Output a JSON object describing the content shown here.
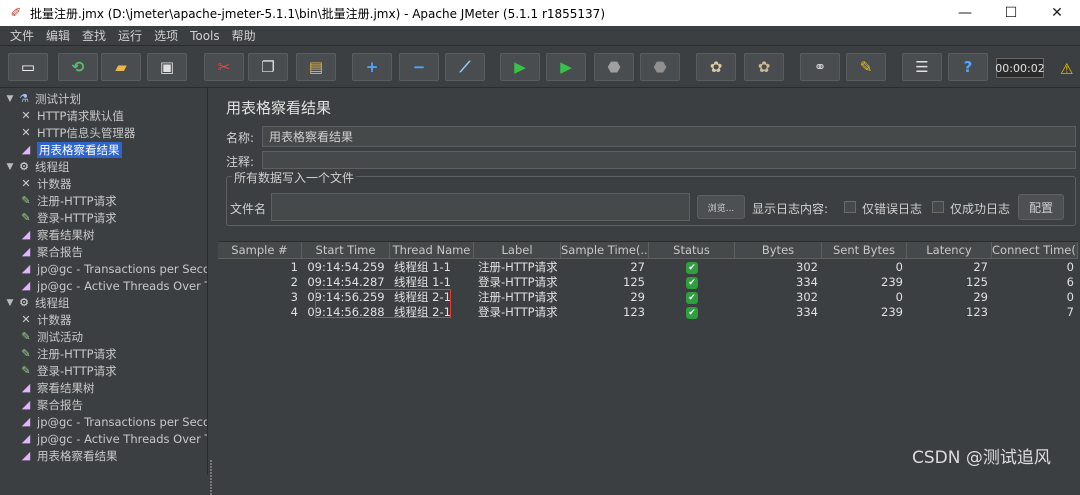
{
  "window": {
    "title": "批量注册.jmx (D:\\jmeter\\apache-jmeter-5.1.1\\bin\\批量注册.jmx) - Apache JMeter (5.1.1 r1855137)",
    "minimize": "—",
    "maximize": "☐",
    "close": "✕",
    "app_icon": "✐"
  },
  "menu": [
    "文件",
    "编辑",
    "查找",
    "运行",
    "选项",
    "Tools",
    "帮助"
  ],
  "toolbar": {
    "buttons": [
      {
        "name": "new-icon",
        "glyph": "▭",
        "color": "#ffffff"
      },
      {
        "name": "templates-icon",
        "glyph": "⟲",
        "color": "#55c06a"
      },
      {
        "name": "open-icon",
        "glyph": "▰",
        "color": "#e8b84a"
      },
      {
        "name": "save-icon",
        "glyph": "▣",
        "color": "#e0e0e0"
      },
      {
        "name": "cut-icon",
        "glyph": "✂",
        "color": "#e04848"
      },
      {
        "name": "copy-icon",
        "glyph": "❐",
        "color": "#e0e0e0"
      },
      {
        "name": "paste-icon",
        "glyph": "▤",
        "color": "#e8b84a"
      },
      {
        "name": "expand-icon",
        "glyph": "+",
        "color": "#4ea6ff"
      },
      {
        "name": "collapse-icon",
        "glyph": "−",
        "color": "#4ea6ff"
      },
      {
        "name": "toggle-icon",
        "glyph": "⟋",
        "color": "#9ad0ff"
      },
      {
        "name": "start-icon",
        "glyph": "▶",
        "color": "#39c24a"
      },
      {
        "name": "start-no-pause-icon",
        "glyph": "▶",
        "color": "#39c24a"
      },
      {
        "name": "stop-icon",
        "glyph": "⬣",
        "color": "#a0a0a0"
      },
      {
        "name": "shutdown-icon",
        "glyph": "⬣",
        "color": "#909090"
      },
      {
        "name": "clear-icon",
        "glyph": "✿",
        "color": "#d8c9a0"
      },
      {
        "name": "clear-all-icon",
        "glyph": "✿",
        "color": "#c9b890"
      },
      {
        "name": "search-icon",
        "glyph": "⚭",
        "color": "#d0d0d0"
      },
      {
        "name": "reset-search-icon",
        "glyph": "✎",
        "color": "#f0c000"
      },
      {
        "name": "function-helper-icon",
        "glyph": "☰",
        "color": "#e0e0e0"
      },
      {
        "name": "help-icon",
        "glyph": "?",
        "color": "#4ea6ff"
      }
    ],
    "timer": "00:00:02",
    "warning": "⚠"
  },
  "tree": [
    {
      "label": "测试计划",
      "icon": "plan-icon",
      "glyph": "⚗",
      "level": 0,
      "twisty": "▼"
    },
    {
      "label": "HTTP请求默认值",
      "icon": "wrench-icon",
      "glyph": "✕",
      "level": 1
    },
    {
      "label": "HTTP信息头管理器",
      "icon": "wrench-icon",
      "glyph": "✕",
      "level": 1
    },
    {
      "label": "用表格察看结果",
      "icon": "graph-icon",
      "glyph": "◢",
      "level": 1,
      "selected": true
    },
    {
      "label": "线程组",
      "icon": "gear-icon",
      "glyph": "⚙",
      "level": 0,
      "twisty": "▼"
    },
    {
      "label": "计数器",
      "icon": "wrench-icon",
      "glyph": "✕",
      "level": 1
    },
    {
      "label": "注册-HTTP请求",
      "icon": "pen-icon",
      "glyph": "✎",
      "level": 1
    },
    {
      "label": "登录-HTTP请求",
      "icon": "pen-icon",
      "glyph": "✎",
      "level": 1
    },
    {
      "label": "察看结果树",
      "icon": "graph-icon",
      "glyph": "◢",
      "level": 1
    },
    {
      "label": "聚合报告",
      "icon": "graph-icon",
      "glyph": "◢",
      "level": 1
    },
    {
      "label": "jp@gc - Transactions per Seco",
      "icon": "graph-icon",
      "glyph": "◢",
      "level": 1
    },
    {
      "label": "jp@gc - Active Threads Over Tir",
      "icon": "graph-icon",
      "glyph": "◢",
      "level": 1
    },
    {
      "label": "线程组",
      "icon": "gear-icon",
      "glyph": "⚙",
      "level": 0,
      "twisty": "▼"
    },
    {
      "label": "计数器",
      "icon": "wrench-icon",
      "glyph": "✕",
      "level": 1
    },
    {
      "label": "测试活动",
      "icon": "pen-icon",
      "glyph": "✎",
      "level": 1
    },
    {
      "label": "注册-HTTP请求",
      "icon": "pen-icon",
      "glyph": "✎",
      "level": 1
    },
    {
      "label": "登录-HTTP请求",
      "icon": "pen-icon",
      "glyph": "✎",
      "level": 1
    },
    {
      "label": "察看结果树",
      "icon": "graph-icon",
      "glyph": "◢",
      "level": 1
    },
    {
      "label": "聚合报告",
      "icon": "graph-icon",
      "glyph": "◢",
      "level": 1
    },
    {
      "label": "jp@gc - Transactions per Seco",
      "icon": "graph-icon",
      "glyph": "◢",
      "level": 1
    },
    {
      "label": "jp@gc - Active Threads Over Tir",
      "icon": "graph-icon",
      "glyph": "◢",
      "level": 1
    },
    {
      "label": "用表格察看结果",
      "icon": "graph-icon",
      "glyph": "◢",
      "level": 1
    }
  ],
  "panel": {
    "title": "用表格察看结果",
    "name_label": "名称:",
    "name_value": "用表格察看结果",
    "comment_label": "注释:",
    "comment_value": "",
    "group_title": "所有数据写入一个文件",
    "filename_label": "文件名",
    "browse": "浏览...",
    "log_label": "显示日志内容:",
    "errors_only": "仅错误日志",
    "success_only": "仅成功日志",
    "configure": "配置"
  },
  "table": {
    "headers": [
      "Sample #",
      "Start Time",
      "Thread Name",
      "Label",
      "Sample Time(...",
      "Status",
      "Bytes",
      "Sent Bytes",
      "Latency",
      "Connect Time(..."
    ],
    "rows": [
      [
        "1",
        "09:14:54.259",
        "线程组 1-1",
        "注册-HTTP请求",
        "27",
        "ok",
        "302",
        "0",
        "27",
        "0"
      ],
      [
        "2",
        "09:14:54.287",
        "线程组 1-1",
        "登录-HTTP请求",
        "125",
        "ok",
        "334",
        "239",
        "125",
        "6"
      ],
      [
        "3",
        "09:14:56.259",
        "线程组 2-1",
        "注册-HTTP请求",
        "29",
        "ok",
        "302",
        "0",
        "29",
        "0"
      ],
      [
        "4",
        "09:14:56.288",
        "线程组 2-1",
        "登录-HTTP请求",
        "123",
        "ok",
        "334",
        "239",
        "123",
        "7"
      ]
    ],
    "status_glyph": "✔"
  },
  "watermark": "CSDN @测试追风"
}
